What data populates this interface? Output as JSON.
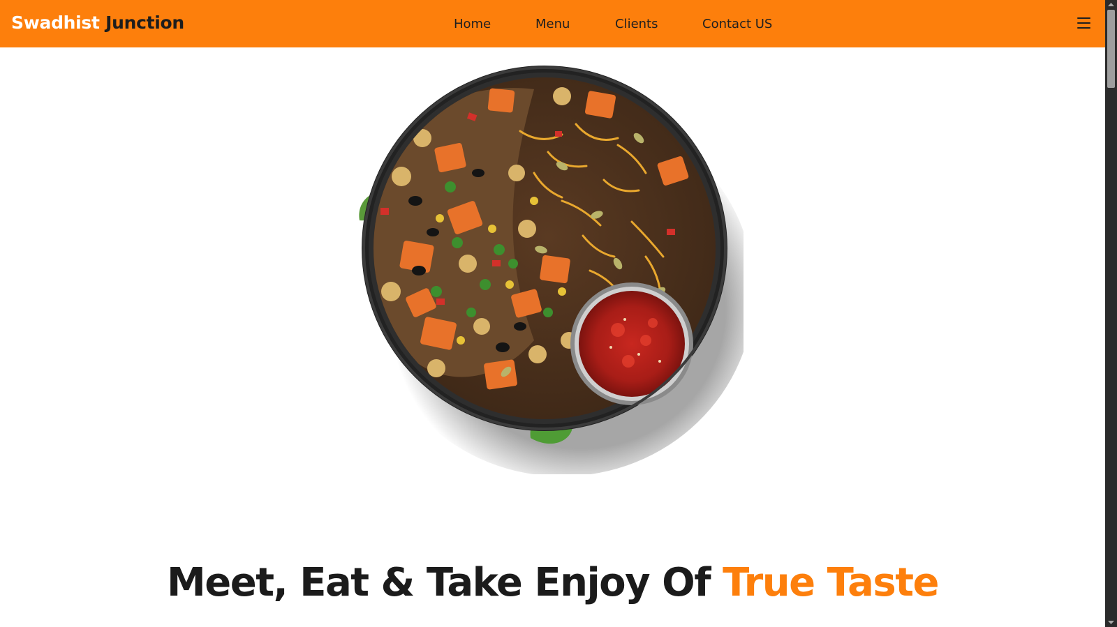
{
  "brand": {
    "part1": "Swadhist",
    "part2": "Junction"
  },
  "nav": {
    "items": [
      {
        "label": "Home"
      },
      {
        "label": "Menu"
      },
      {
        "label": "Clients"
      },
      {
        "label": "Contact US"
      }
    ],
    "menu_icon": "hamburger-menu-icon"
  },
  "hero": {
    "image": "food-bowl-photo",
    "headline_main": "Meet, Eat & Take Enjoy Of",
    "headline_accent": "True Taste"
  },
  "colors": {
    "accent": "#fd7f0c",
    "text_dark": "#1b1b1b",
    "background": "#ffffff"
  }
}
